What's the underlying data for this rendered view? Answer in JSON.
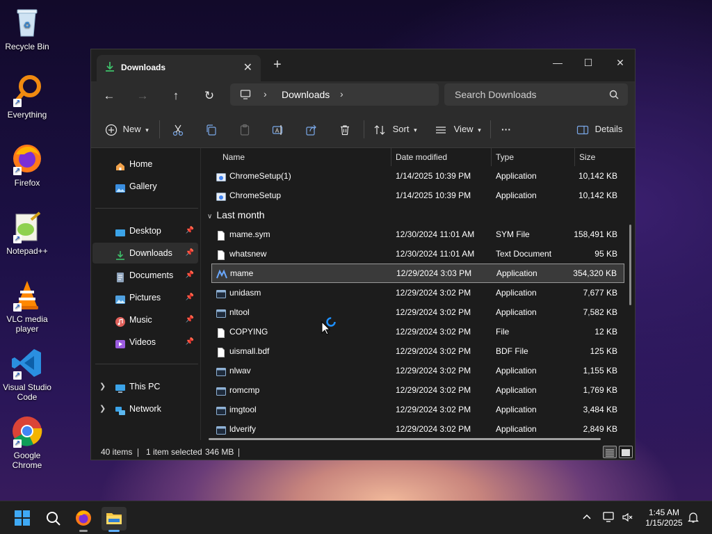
{
  "desktop": {
    "icons": [
      {
        "label": "Recycle Bin"
      },
      {
        "label": "Everything"
      },
      {
        "label": "Firefox"
      },
      {
        "label": "Notepad++"
      },
      {
        "label": "VLC media player"
      },
      {
        "label": "Visual Studio Code"
      },
      {
        "label": "Google Chrome"
      }
    ]
  },
  "window": {
    "tab_title": "Downloads",
    "address": {
      "crumb": "Downloads"
    },
    "search_placeholder": "Search Downloads",
    "toolbar": {
      "new_label": "New",
      "sort_label": "Sort",
      "view_label": "View",
      "more_label": "···",
      "details_label": "Details"
    },
    "nav": {
      "items": [
        {
          "label": "Home",
          "icon": "home-icon"
        },
        {
          "label": "Gallery",
          "icon": "gallery-icon"
        },
        {
          "label": "Desktop",
          "icon": "desktop-icon",
          "pinned": true
        },
        {
          "label": "Downloads",
          "icon": "download-icon",
          "pinned": true,
          "selected": true
        },
        {
          "label": "Documents",
          "icon": "documents-icon",
          "pinned": true
        },
        {
          "label": "Pictures",
          "icon": "pictures-icon",
          "pinned": true
        },
        {
          "label": "Music",
          "icon": "music-icon",
          "pinned": true
        },
        {
          "label": "Videos",
          "icon": "videos-icon",
          "pinned": true
        },
        {
          "label": "This PC",
          "icon": "computer-icon"
        },
        {
          "label": "Network",
          "icon": "network-icon"
        }
      ]
    },
    "columns": {
      "name": "Name",
      "date": "Date modified",
      "type": "Type",
      "size": "Size"
    },
    "group_label": "Last month",
    "files_top": [
      {
        "name": "ChromeSetup(1)",
        "date": "1/14/2025 10:39 PM",
        "type": "Application",
        "size": "10,142 KB"
      },
      {
        "name": "ChromeSetup",
        "date": "1/14/2025 10:39 PM",
        "type": "Application",
        "size": "10,142 KB"
      }
    ],
    "files": [
      {
        "name": "mame.sym",
        "date": "12/30/2024 11:01 AM",
        "type": "SYM File",
        "size": "158,491 KB"
      },
      {
        "name": "whatsnew",
        "date": "12/30/2024 11:01 AM",
        "type": "Text Document",
        "size": "95 KB"
      },
      {
        "name": "mame",
        "date": "12/29/2024 3:03 PM",
        "type": "Application",
        "size": "354,320 KB"
      },
      {
        "name": "unidasm",
        "date": "12/29/2024 3:02 PM",
        "type": "Application",
        "size": "7,677 KB"
      },
      {
        "name": "nltool",
        "date": "12/29/2024 3:02 PM",
        "type": "Application",
        "size": "7,582 KB"
      },
      {
        "name": "COPYING",
        "date": "12/29/2024 3:02 PM",
        "type": "File",
        "size": "12 KB"
      },
      {
        "name": "uismall.bdf",
        "date": "12/29/2024 3:02 PM",
        "type": "BDF File",
        "size": "125 KB"
      },
      {
        "name": "nlwav",
        "date": "12/29/2024 3:02 PM",
        "type": "Application",
        "size": "1,155 KB"
      },
      {
        "name": "romcmp",
        "date": "12/29/2024 3:02 PM",
        "type": "Application",
        "size": "1,769 KB"
      },
      {
        "name": "imgtool",
        "date": "12/29/2024 3:02 PM",
        "type": "Application",
        "size": "3,484 KB"
      },
      {
        "name": "ldverify",
        "date": "12/29/2024 3:02 PM",
        "type": "Application",
        "size": "2,849 KB"
      }
    ],
    "status": {
      "items": "40 items",
      "selected": "1 item selected",
      "size": "346 MB"
    }
  },
  "taskbar": {
    "clock_time": "1:45 AM",
    "clock_date": "1/15/2025"
  }
}
